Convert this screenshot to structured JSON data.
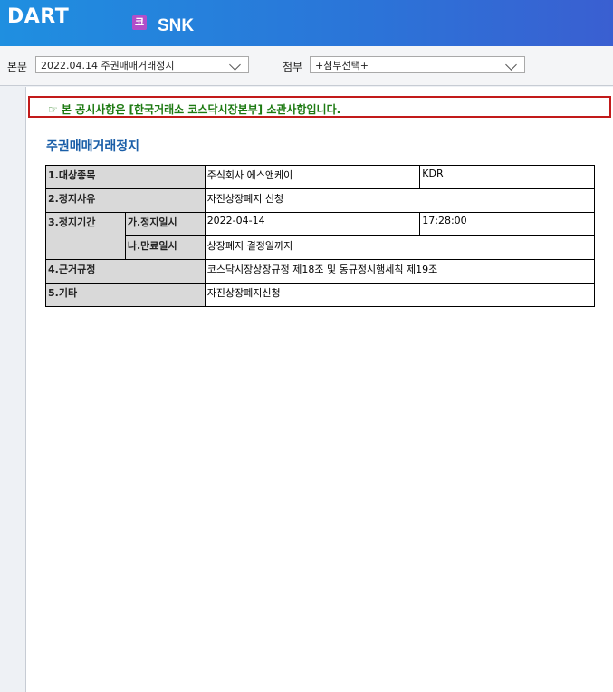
{
  "header": {
    "logo_text": "DART",
    "corp_badge": "코",
    "corp_name": "SNK"
  },
  "toolbar": {
    "main_label": "본문",
    "main_select": "2022.04.14  주권매매거래정지",
    "attach_label": "첨부",
    "attach_select": "+첨부선택+"
  },
  "notice": "☞ 본 공시사항은 [한국거래소 코스닥시장본부] 소관사항입니다.",
  "doc_title": "주권매매거래정지",
  "table": {
    "r1_label": "1.대상종목",
    "r1_value": "주식회사 에스앤케이",
    "r1_code": "KDR",
    "r2_label": "2.정지사유",
    "r2_value": "자진상장폐지 신청",
    "r3_label": "3.정지기간",
    "r3a_label": "가.정지일시",
    "r3a_date": "2022-04-14",
    "r3a_time": "17:28:00",
    "r3b_label": "나.만료일시",
    "r3b_value": "상장폐지 결정일까지",
    "r4_label": "4.근거규정",
    "r4_value": "코스닥시장상장규정 제18조 및 동규정시행세칙 제19조",
    "r5_label": "5.기타",
    "r5_value": "자진상장폐지신청"
  }
}
